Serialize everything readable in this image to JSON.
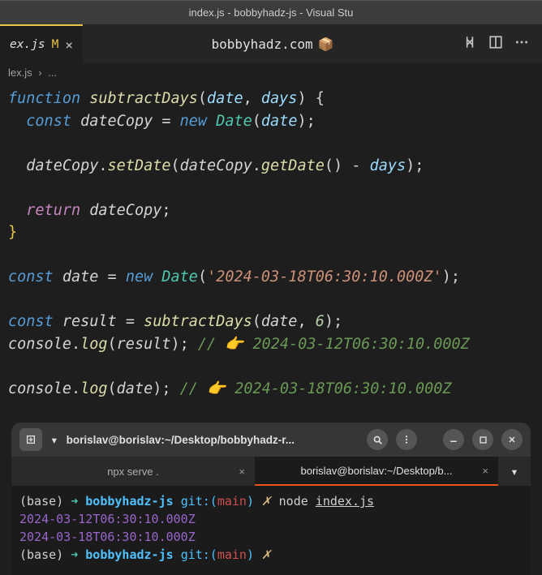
{
  "window": {
    "title": "index.js - bobbyhadz-js - Visual Stu"
  },
  "tab": {
    "filename": "ex.js",
    "modified_indicator": "M",
    "close": "×",
    "center_text": "bobbyhadz.com",
    "center_emoji": "📦"
  },
  "breadcrumb": {
    "file": "lex.js",
    "separator": "›",
    "rest": "..."
  },
  "code": {
    "lines": [
      {
        "t": "fn_decl",
        "kw": "function",
        "name": "subtractDays",
        "params": [
          "date",
          "days"
        ]
      },
      {
        "t": "const_new",
        "kw": "const",
        "var": "dateCopy",
        "op": "=",
        "newkw": "new",
        "cls": "Date",
        "arg": "date"
      },
      {
        "t": "blank"
      },
      {
        "t": "call",
        "obj": "dateCopy",
        "method": "setDate",
        "inner_obj": "dateCopy",
        "inner_method": "getDate",
        "op": "-",
        "rhs": "days"
      },
      {
        "t": "blank"
      },
      {
        "t": "return",
        "kw": "return",
        "var": "dateCopy"
      },
      {
        "t": "close_brace"
      },
      {
        "t": "blank"
      },
      {
        "t": "const_new_str",
        "kw": "const",
        "var": "date",
        "newkw": "new",
        "cls": "Date",
        "str": "'2024-03-18T06:30:10.000Z'"
      },
      {
        "t": "blank"
      },
      {
        "t": "const_call",
        "kw": "const",
        "var": "result",
        "fn": "subtractDays",
        "arg1": "date",
        "arg2": "6"
      },
      {
        "t": "log",
        "obj": "console",
        "method": "log",
        "arg": "result",
        "comment": "// 👉️ 2024-03-12T06:30:10.000Z"
      },
      {
        "t": "blank"
      },
      {
        "t": "log",
        "obj": "console",
        "method": "log",
        "arg": "date",
        "comment": "// 👉️ 2024-03-18T06:30:10.000Z"
      }
    ]
  },
  "terminal": {
    "toolbar_title": "borislav@borislav:~/Desktop/bobbyhadz-r...",
    "tabs": [
      {
        "label": "npx serve .",
        "active": false
      },
      {
        "label": "borislav@borislav:~/Desktop/b...",
        "active": true
      }
    ],
    "prompt": {
      "base": "(base)",
      "arrow": "➜",
      "dir": "bobbyhadz-js",
      "git_label": "git:(",
      "branch": "main",
      "git_close": ")",
      "dirty": "✗"
    },
    "command": "node index.js",
    "output_lines": [
      "2024-03-12T06:30:10.000Z",
      "2024-03-18T06:30:10.000Z"
    ]
  }
}
